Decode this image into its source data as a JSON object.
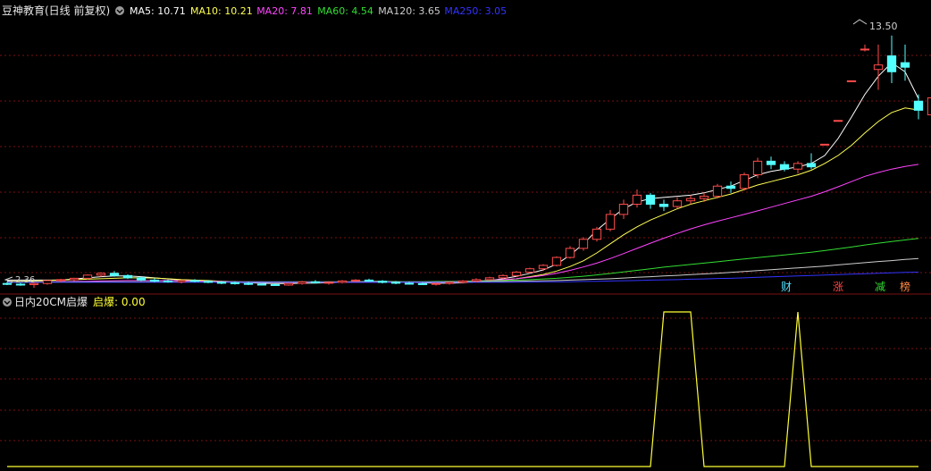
{
  "main_panel": {
    "title": "豆神教育(日线 前复权)",
    "ma_legend": [
      {
        "label": "MA5: 10.71",
        "color": "#ffffff"
      },
      {
        "label": "MA10: 10.21",
        "color": "#ffff55"
      },
      {
        "label": "MA20: 7.81",
        "color": "#ff44ff"
      },
      {
        "label": "MA60: 4.54",
        "color": "#33dd33"
      },
      {
        "label": "MA120: 3.65",
        "color": "#cccccc"
      },
      {
        "label": "MA250: 3.05",
        "color": "#3333ff"
      }
    ],
    "high_label": "13.50",
    "low_label": "2.36",
    "markers": [
      {
        "text": "财",
        "color": "#55e0ff"
      },
      {
        "text": "涨",
        "color": "#ff4444"
      },
      {
        "text": "减",
        "color": "#33dd33"
      },
      {
        "text": "榜",
        "color": "#ff8844"
      }
    ]
  },
  "sub_panel": {
    "indicator_name": "日内20CM启爆",
    "value_label": "启爆: 0.00"
  },
  "colors": {
    "background": "#000000",
    "grid": "#7a1010",
    "up_candle": "#ff4b4b",
    "down_candle": "#54ffff",
    "indicator_line": "#ffff33"
  },
  "chart_data": [
    {
      "type": "candlestick",
      "x": [
        1,
        2,
        3,
        4,
        5,
        6,
        7,
        8,
        9,
        10,
        11,
        12,
        13,
        14,
        15,
        16,
        17,
        18,
        19,
        20,
        21,
        22,
        23,
        24,
        25,
        26,
        27,
        28,
        29,
        30,
        31,
        32,
        33,
        34,
        35,
        36,
        37,
        38,
        39,
        40,
        41,
        42,
        43,
        44,
        45,
        46,
        47,
        48,
        49,
        50,
        51,
        52,
        53,
        54,
        55,
        56,
        57,
        58,
        59,
        60,
        61,
        62,
        63,
        64,
        65,
        66,
        67,
        68,
        69
      ],
      "ohlc": [
        [
          2.55,
          2.62,
          2.48,
          2.52
        ],
        [
          2.52,
          2.58,
          2.45,
          2.5
        ],
        [
          2.5,
          2.6,
          2.36,
          2.55
        ],
        [
          2.55,
          2.7,
          2.5,
          2.68
        ],
        [
          2.68,
          2.75,
          2.6,
          2.72
        ],
        [
          2.72,
          2.8,
          2.65,
          2.78
        ],
        [
          2.78,
          2.95,
          2.72,
          2.92
        ],
        [
          2.92,
          3.05,
          2.85,
          3.0
        ],
        [
          3.0,
          3.1,
          2.85,
          2.9
        ],
        [
          2.9,
          2.95,
          2.75,
          2.8
        ],
        [
          2.8,
          2.85,
          2.65,
          2.7
        ],
        [
          2.7,
          2.78,
          2.6,
          2.66
        ],
        [
          2.66,
          2.72,
          2.58,
          2.62
        ],
        [
          2.62,
          2.7,
          2.55,
          2.68
        ],
        [
          2.68,
          2.74,
          2.6,
          2.64
        ],
        [
          2.64,
          2.7,
          2.56,
          2.6
        ],
        [
          2.6,
          2.66,
          2.52,
          2.58
        ],
        [
          2.58,
          2.64,
          2.5,
          2.55
        ],
        [
          2.55,
          2.62,
          2.48,
          2.52
        ],
        [
          2.52,
          2.58,
          2.46,
          2.5
        ],
        [
          2.5,
          2.56,
          2.44,
          2.48
        ],
        [
          2.48,
          2.58,
          2.45,
          2.55
        ],
        [
          2.55,
          2.66,
          2.5,
          2.62
        ],
        [
          2.62,
          2.7,
          2.55,
          2.58
        ],
        [
          2.58,
          2.65,
          2.5,
          2.6
        ],
        [
          2.6,
          2.7,
          2.55,
          2.66
        ],
        [
          2.66,
          2.74,
          2.6,
          2.7
        ],
        [
          2.7,
          2.76,
          2.62,
          2.65
        ],
        [
          2.65,
          2.7,
          2.55,
          2.6
        ],
        [
          2.6,
          2.66,
          2.52,
          2.56
        ],
        [
          2.56,
          2.62,
          2.5,
          2.54
        ],
        [
          2.54,
          2.6,
          2.48,
          2.52
        ],
        [
          2.52,
          2.58,
          2.46,
          2.55
        ],
        [
          2.55,
          2.64,
          2.5,
          2.6
        ],
        [
          2.6,
          2.7,
          2.55,
          2.66
        ],
        [
          2.66,
          2.78,
          2.6,
          2.72
        ],
        [
          2.72,
          2.85,
          2.68,
          2.8
        ],
        [
          2.8,
          2.95,
          2.75,
          2.9
        ],
        [
          2.9,
          3.1,
          2.85,
          3.05
        ],
        [
          3.05,
          3.25,
          3.0,
          3.2
        ],
        [
          3.2,
          3.4,
          3.1,
          3.35
        ],
        [
          3.35,
          3.75,
          3.3,
          3.7
        ],
        [
          3.7,
          4.2,
          3.65,
          4.1
        ],
        [
          4.1,
          4.6,
          4.0,
          4.5
        ],
        [
          4.5,
          5.05,
          4.4,
          4.95
        ],
        [
          4.95,
          5.8,
          4.85,
          5.6
        ],
        [
          5.6,
          6.25,
          5.4,
          6.05
        ],
        [
          6.05,
          6.7,
          5.9,
          6.45
        ],
        [
          6.45,
          6.55,
          5.85,
          6.05
        ],
        [
          6.05,
          6.25,
          5.75,
          5.95
        ],
        [
          5.95,
          6.35,
          5.85,
          6.2
        ],
        [
          6.2,
          6.45,
          6.05,
          6.3
        ],
        [
          6.3,
          6.55,
          6.15,
          6.4
        ],
        [
          6.4,
          6.95,
          6.3,
          6.85
        ],
        [
          6.85,
          7.05,
          6.55,
          6.75
        ],
        [
          6.75,
          7.45,
          6.65,
          7.35
        ],
        [
          7.35,
          8.1,
          7.2,
          7.95
        ],
        [
          7.95,
          8.15,
          7.6,
          7.8
        ],
        [
          7.8,
          7.95,
          7.5,
          7.6
        ],
        [
          7.6,
          7.95,
          7.4,
          7.85
        ],
        [
          7.85,
          8.3,
          7.6,
          7.7
        ],
        [
          8.7,
          8.7,
          8.7,
          8.7
        ],
        [
          9.75,
          9.75,
          9.75,
          9.75
        ],
        [
          11.5,
          11.5,
          11.5,
          11.5
        ],
        [
          12.9,
          13.1,
          12.8,
          12.9
        ],
        [
          12.0,
          13.1,
          11.1,
          12.2
        ],
        [
          12.6,
          13.5,
          11.4,
          11.9
        ],
        [
          12.3,
          13.1,
          11.5,
          12.1
        ],
        [
          10.6,
          10.9,
          9.8,
          10.2
        ],
        [
          10.0,
          10.9,
          9.7,
          10.75
        ]
      ],
      "ma": {
        "MA5": [
          2.7,
          2.7,
          2.7,
          2.7,
          2.7,
          2.75,
          2.8,
          2.85,
          2.88,
          2.88,
          2.85,
          2.8,
          2.75,
          2.7,
          2.66,
          2.64,
          2.62,
          2.6,
          2.58,
          2.56,
          2.55,
          2.55,
          2.56,
          2.57,
          2.58,
          2.6,
          2.62,
          2.64,
          2.64,
          2.63,
          2.61,
          2.58,
          2.56,
          2.56,
          2.58,
          2.62,
          2.68,
          2.76,
          2.86,
          3.0,
          3.15,
          3.4,
          3.8,
          4.3,
          4.9,
          5.4,
          5.85,
          6.15,
          6.3,
          6.35,
          6.4,
          6.45,
          6.55,
          6.7,
          6.85,
          7.1,
          7.35,
          7.5,
          7.6,
          7.7,
          7.85,
          8.2,
          8.95,
          9.9,
          10.9,
          11.7,
          12.3,
          11.9,
          10.71
        ],
        "MA10": [
          2.65,
          2.65,
          2.66,
          2.68,
          2.7,
          2.72,
          2.74,
          2.76,
          2.78,
          2.8,
          2.8,
          2.79,
          2.76,
          2.72,
          2.7,
          2.68,
          2.65,
          2.63,
          2.61,
          2.6,
          2.59,
          2.58,
          2.58,
          2.58,
          2.59,
          2.6,
          2.61,
          2.61,
          2.61,
          2.61,
          2.6,
          2.6,
          2.6,
          2.6,
          2.6,
          2.62,
          2.65,
          2.7,
          2.76,
          2.85,
          2.95,
          3.1,
          3.3,
          3.55,
          3.9,
          4.3,
          4.7,
          5.05,
          5.35,
          5.6,
          5.85,
          6.05,
          6.2,
          6.35,
          6.5,
          6.7,
          6.9,
          7.05,
          7.2,
          7.35,
          7.55,
          7.85,
          8.2,
          8.65,
          9.2,
          9.7,
          10.1,
          10.3,
          10.21
        ],
        "MA20": [
          2.6,
          2.6,
          2.61,
          2.62,
          2.63,
          2.64,
          2.65,
          2.66,
          2.67,
          2.68,
          2.68,
          2.68,
          2.68,
          2.67,
          2.66,
          2.65,
          2.64,
          2.63,
          2.62,
          2.62,
          2.61,
          2.6,
          2.6,
          2.6,
          2.6,
          2.6,
          2.6,
          2.6,
          2.6,
          2.61,
          2.61,
          2.61,
          2.62,
          2.63,
          2.64,
          2.66,
          2.69,
          2.72,
          2.76,
          2.82,
          2.9,
          3.0,
          3.13,
          3.28,
          3.45,
          3.65,
          3.87,
          4.1,
          4.33,
          4.55,
          4.76,
          4.96,
          5.14,
          5.3,
          5.45,
          5.6,
          5.76,
          5.92,
          6.08,
          6.24,
          6.4,
          6.6,
          6.82,
          7.05,
          7.28,
          7.45,
          7.6,
          7.72,
          7.81
        ],
        "MA60": [
          2.6,
          2.6,
          2.6,
          2.6,
          2.61,
          2.61,
          2.61,
          2.62,
          2.62,
          2.62,
          2.62,
          2.62,
          2.62,
          2.62,
          2.62,
          2.62,
          2.62,
          2.62,
          2.62,
          2.62,
          2.62,
          2.62,
          2.62,
          2.62,
          2.62,
          2.62,
          2.62,
          2.62,
          2.62,
          2.63,
          2.63,
          2.63,
          2.64,
          2.64,
          2.65,
          2.66,
          2.67,
          2.68,
          2.7,
          2.72,
          2.75,
          2.78,
          2.82,
          2.87,
          2.93,
          2.99,
          3.06,
          3.13,
          3.2,
          3.27,
          3.33,
          3.39,
          3.45,
          3.51,
          3.57,
          3.63,
          3.69,
          3.75,
          3.81,
          3.87,
          3.93,
          4.0,
          4.08,
          4.16,
          4.25,
          4.33,
          4.4,
          4.47,
          4.54
        ],
        "MA120": [
          2.62,
          2.62,
          2.62,
          2.62,
          2.62,
          2.62,
          2.62,
          2.62,
          2.62,
          2.62,
          2.62,
          2.62,
          2.62,
          2.62,
          2.62,
          2.62,
          2.62,
          2.62,
          2.62,
          2.62,
          2.62,
          2.62,
          2.62,
          2.62,
          2.62,
          2.62,
          2.62,
          2.62,
          2.62,
          2.62,
          2.62,
          2.62,
          2.62,
          2.63,
          2.63,
          2.63,
          2.64,
          2.64,
          2.65,
          2.66,
          2.67,
          2.68,
          2.7,
          2.72,
          2.74,
          2.76,
          2.79,
          2.82,
          2.85,
          2.88,
          2.91,
          2.94,
          2.97,
          3.0,
          3.04,
          3.08,
          3.12,
          3.16,
          3.2,
          3.24,
          3.28,
          3.32,
          3.37,
          3.42,
          3.47,
          3.52,
          3.56,
          3.61,
          3.65
        ],
        "MA250": [
          2.6,
          2.6,
          2.6,
          2.6,
          2.6,
          2.6,
          2.6,
          2.6,
          2.6,
          2.6,
          2.6,
          2.6,
          2.6,
          2.6,
          2.6,
          2.6,
          2.6,
          2.6,
          2.6,
          2.6,
          2.6,
          2.6,
          2.6,
          2.6,
          2.6,
          2.6,
          2.6,
          2.6,
          2.6,
          2.6,
          2.6,
          2.6,
          2.6,
          2.6,
          2.6,
          2.6,
          2.6,
          2.6,
          2.61,
          2.61,
          2.62,
          2.62,
          2.63,
          2.64,
          2.65,
          2.66,
          2.67,
          2.68,
          2.7,
          2.71,
          2.72,
          2.74,
          2.75,
          2.77,
          2.78,
          2.8,
          2.82,
          2.84,
          2.86,
          2.88,
          2.9,
          2.92,
          2.94,
          2.96,
          2.98,
          3.0,
          3.02,
          3.04,
          3.05
        ]
      },
      "ylim": [
        2.36,
        14.2
      ],
      "grid": true
    },
    {
      "type": "line",
      "name": "启爆",
      "x": [
        1,
        2,
        3,
        4,
        5,
        6,
        7,
        8,
        9,
        10,
        11,
        12,
        13,
        14,
        15,
        16,
        17,
        18,
        19,
        20,
        21,
        22,
        23,
        24,
        25,
        26,
        27,
        28,
        29,
        30,
        31,
        32,
        33,
        34,
        35,
        36,
        37,
        38,
        39,
        40,
        41,
        42,
        43,
        44,
        45,
        46,
        47,
        48,
        49,
        50,
        51,
        52,
        53,
        54,
        55,
        56,
        57,
        58,
        59,
        60,
        61,
        62,
        63,
        64,
        65,
        66,
        67,
        68,
        69
      ],
      "values": [
        0,
        0,
        0,
        0,
        0,
        0,
        0,
        0,
        0,
        0,
        0,
        0,
        0,
        0,
        0,
        0,
        0,
        0,
        0,
        0,
        0,
        0,
        0,
        0,
        0,
        0,
        0,
        0,
        0,
        0,
        0,
        0,
        0,
        0,
        0,
        0,
        0,
        0,
        0,
        0,
        0,
        0,
        0,
        0,
        0,
        0,
        0,
        0,
        0,
        1,
        1,
        1,
        0,
        0,
        0,
        0,
        0,
        0,
        0,
        1,
        0,
        0,
        0,
        0,
        0,
        0,
        0,
        0,
        0
      ],
      "ylim": [
        0,
        1
      ],
      "grid": true
    }
  ]
}
